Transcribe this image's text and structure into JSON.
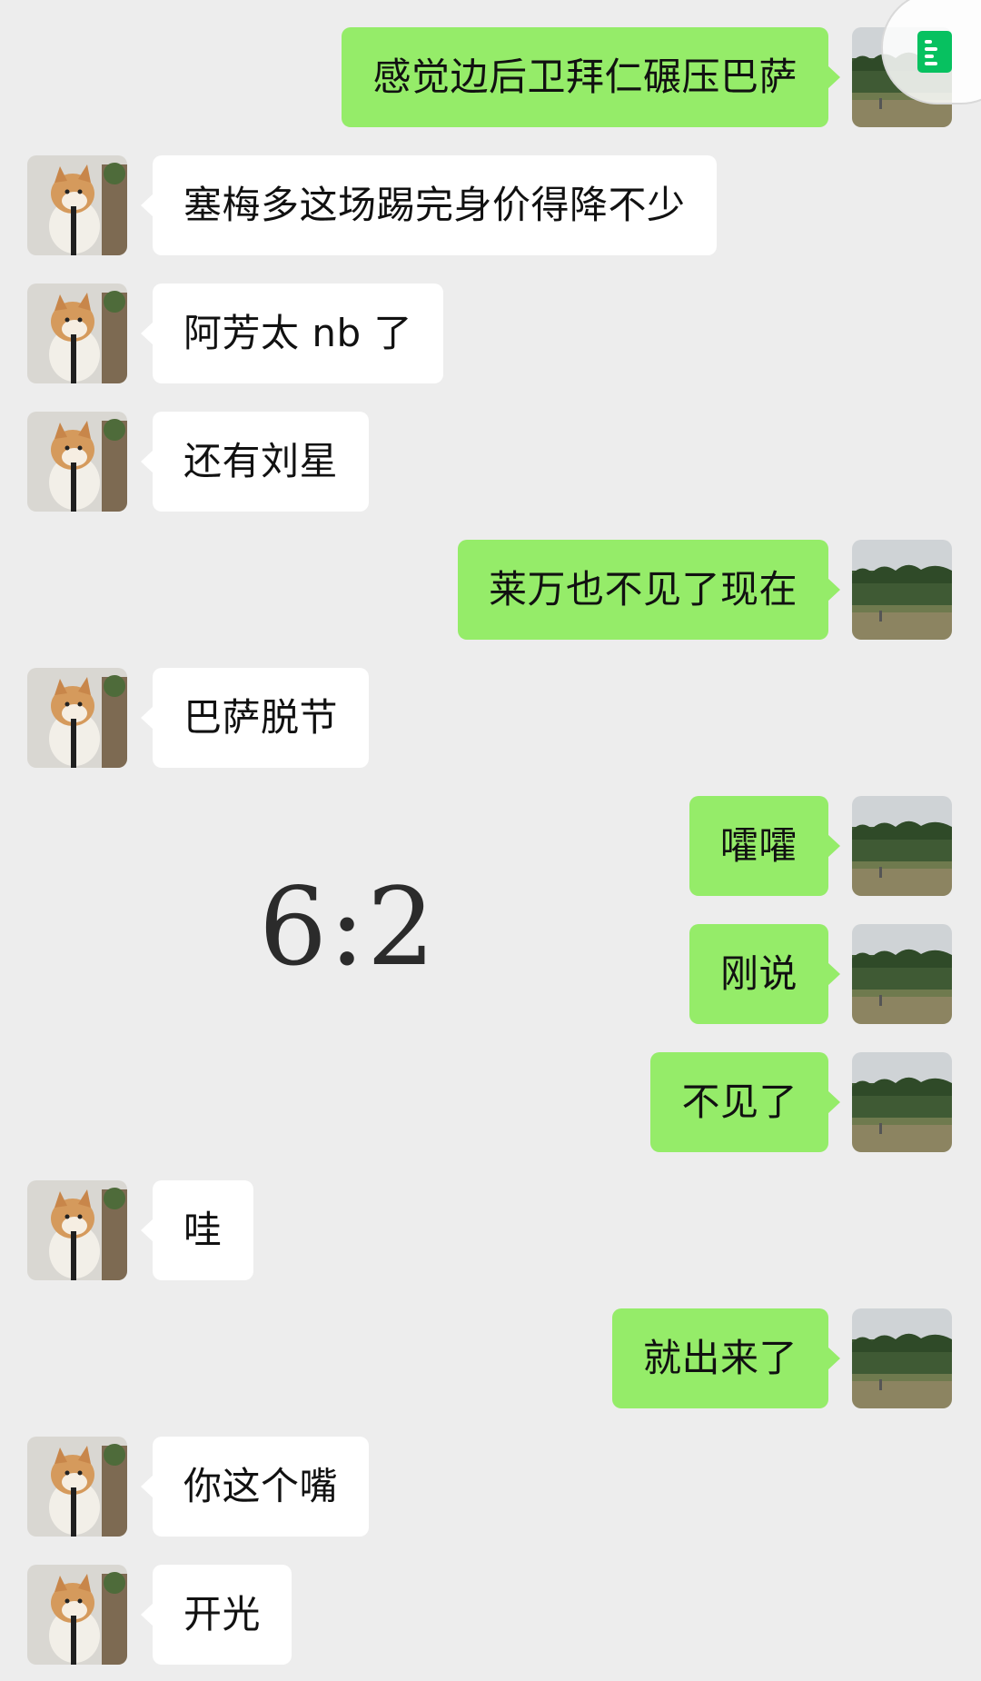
{
  "floating_widget": {
    "icon": "note-icon",
    "color": "#07c160"
  },
  "overlay": {
    "score": "6:2"
  },
  "colors": {
    "background": "#ededed",
    "outgoing_bubble": "#95ec69",
    "incoming_bubble": "#ffffff"
  },
  "avatars": {
    "incoming": "shiba-dog-avatar",
    "outgoing": "field-landscape-avatar"
  },
  "messages": [
    {
      "side": "right",
      "text": "感觉边后卫拜仁碾压巴萨"
    },
    {
      "side": "left",
      "text": "塞梅多这场踢完身价得降不少"
    },
    {
      "side": "left",
      "text": "阿芳太 nb 了"
    },
    {
      "side": "left",
      "text": "还有刘星"
    },
    {
      "side": "right",
      "text": "莱万也不见了现在"
    },
    {
      "side": "left",
      "text": "巴萨脱节"
    },
    {
      "side": "right",
      "text": "嚯嚯"
    },
    {
      "side": "right",
      "text": "刚说"
    },
    {
      "side": "right",
      "text": "不见了"
    },
    {
      "side": "left",
      "text": "哇"
    },
    {
      "side": "right",
      "text": "就出来了"
    },
    {
      "side": "left",
      "text": "你这个嘴"
    },
    {
      "side": "left",
      "text": "开光"
    }
  ]
}
